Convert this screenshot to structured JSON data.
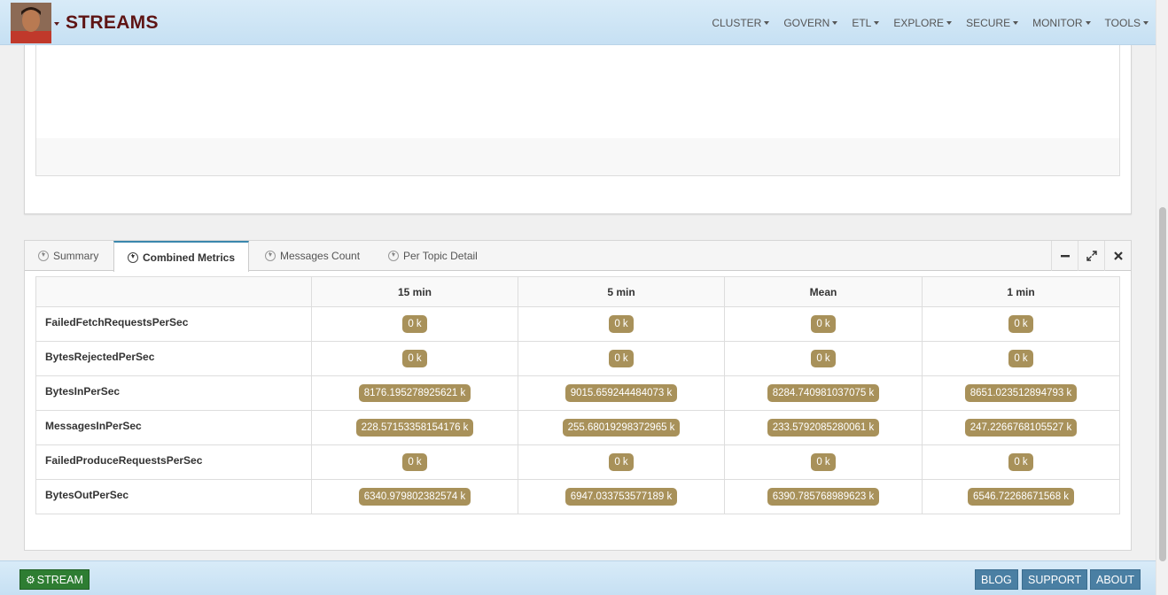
{
  "header": {
    "brand": "STREAMS",
    "nav": [
      "CLUSTER",
      "GOVERN",
      "ETL",
      "EXPLORE",
      "SECURE",
      "MONITOR",
      "TOOLS"
    ]
  },
  "tabs": [
    {
      "label": "Summary"
    },
    {
      "label": "Combined Metrics"
    },
    {
      "label": "Messages Count"
    },
    {
      "label": "Per Topic Detail"
    }
  ],
  "table": {
    "columns": [
      "15 min",
      "5 min",
      "Mean",
      "1 min"
    ],
    "rows": [
      {
        "metric": "FailedFetchRequestsPerSec",
        "values": [
          "0 k",
          "0 k",
          "0 k",
          "0 k"
        ]
      },
      {
        "metric": "BytesRejectedPerSec",
        "values": [
          "0 k",
          "0 k",
          "0 k",
          "0 k"
        ]
      },
      {
        "metric": "BytesInPerSec",
        "values": [
          "8176.195278925621 k",
          "9015.659244484073 k",
          "8284.740981037075 k",
          "8651.023512894793 k"
        ]
      },
      {
        "metric": "MessagesInPerSec",
        "values": [
          "228.57153358154176 k",
          "255.68019298372965 k",
          "233.5792085280061 k",
          "247.2266768105527 k"
        ]
      },
      {
        "metric": "FailedProduceRequestsPerSec",
        "values": [
          "0 k",
          "0 k",
          "0 k",
          "0 k"
        ]
      },
      {
        "metric": "BytesOutPerSec",
        "values": [
          "6340.979802382574 k",
          "6947.033753577189 k",
          "6390.785768989623 k",
          "6546.72268671568 k"
        ]
      }
    ]
  },
  "footer": {
    "stream_label": "STREAM",
    "blog_label": "BLOG",
    "support_label": "SUPPORT",
    "about_label": "ABOUT"
  },
  "colors": {
    "brand": "#5e1414",
    "badge": "#a8915a",
    "stream_button": "#2e7d32",
    "footer_button": "#4a7fa3"
  }
}
